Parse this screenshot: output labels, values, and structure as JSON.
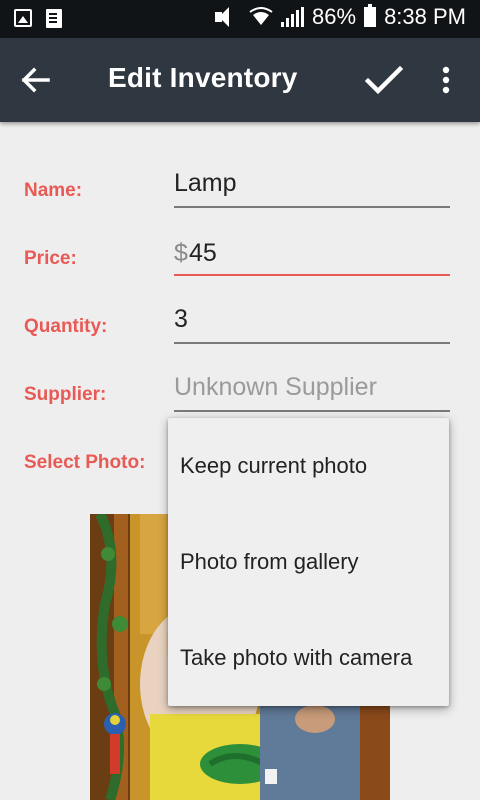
{
  "status_bar": {
    "battery_percent": "86%",
    "time": "8:38 PM",
    "icons": [
      "image-notification-icon",
      "document-notification-icon",
      "vibrate-mute-icon",
      "wifi-icon",
      "signal-icon",
      "battery-icon"
    ]
  },
  "app_bar": {
    "title": "Edit Inventory",
    "icons": [
      "back-arrow-icon",
      "checkmark-icon",
      "more-vert-icon"
    ]
  },
  "form": {
    "name": {
      "label": "Name:",
      "value": "Lamp"
    },
    "price": {
      "label": "Price:",
      "currency": "$",
      "value": "45"
    },
    "quantity": {
      "label": "Quantity:",
      "value": "3"
    },
    "supplier": {
      "label": "Supplier:",
      "value": "",
      "placeholder": "Unknown Supplier"
    },
    "photo": {
      "label": "Select Photo:"
    }
  },
  "photo_menu": {
    "items": [
      "Keep current photo",
      "Photo from gallery",
      "Take photo with camera"
    ]
  },
  "colors": {
    "accent": "#e85a55",
    "app_bar": "#2f3740",
    "status_bar": "#111417",
    "background": "#eeeeee"
  }
}
